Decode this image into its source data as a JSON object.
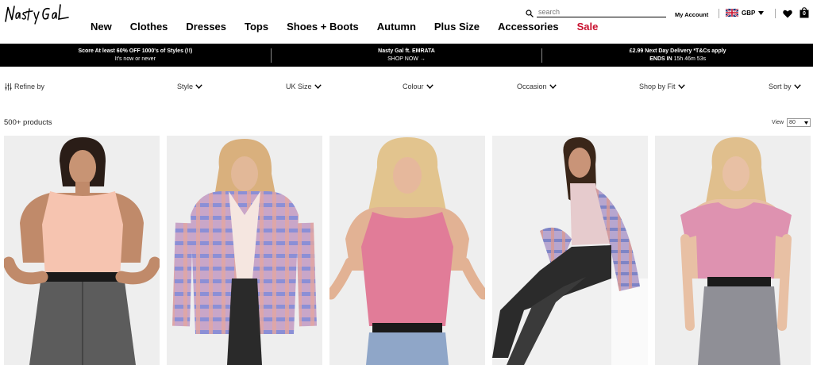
{
  "brand": {
    "logo_text": "Nasty Gal"
  },
  "nav": [
    {
      "label": "New"
    },
    {
      "label": "Clothes"
    },
    {
      "label": "Dresses"
    },
    {
      "label": "Tops"
    },
    {
      "label": "Shoes + Boots"
    },
    {
      "label": "Autumn"
    },
    {
      "label": "Plus Size"
    },
    {
      "label": "Accessories"
    },
    {
      "label": "Sale"
    }
  ],
  "search": {
    "placeholder": "search"
  },
  "account": {
    "label": "My Account"
  },
  "currency": {
    "code": "GBP"
  },
  "bag": {
    "count": "0"
  },
  "promo": [
    {
      "line1": "Score At least 60% OFF 1000's of Styles (!!)",
      "line2": "It's now or never"
    },
    {
      "line1": "Nasty Gal ft. EMRATA",
      "line2": "SHOP NOW →"
    },
    {
      "line1": "£2.99 Next Day Delivery *T&Cs apply",
      "line2_bold": "ENDS IN",
      "line2": "15h 46m 53s"
    }
  ],
  "filters": {
    "refine": "Refine by",
    "style": "Style",
    "size": "UK Size",
    "colour": "Colour",
    "occasion": "Occasion",
    "fit": "Shop by Fit",
    "sort": "Sort by"
  },
  "results": {
    "count": "500+ products",
    "view_label": "View",
    "view_value": "80"
  },
  "colors": {
    "sale": "#c8102e",
    "promo_bg": "#000000"
  }
}
